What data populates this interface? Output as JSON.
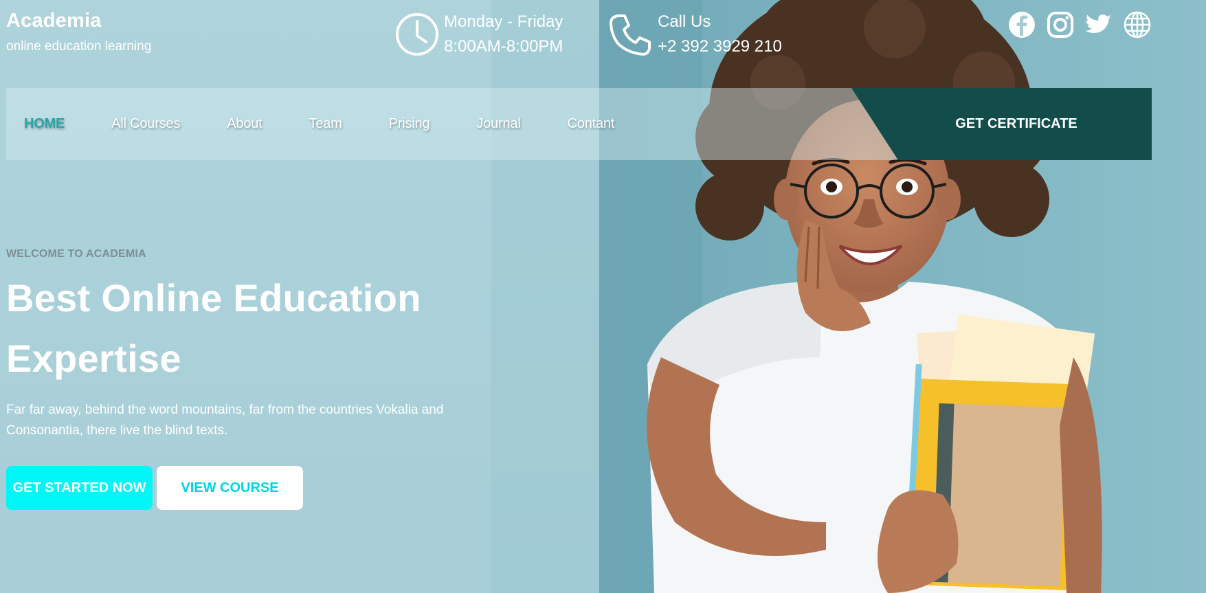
{
  "brand": {
    "name": "Academia",
    "tagline": "online education learning"
  },
  "contact": {
    "hours_title": "Monday - Friday",
    "hours_value": "8:00AM-8:00PM",
    "call_title": "Call Us",
    "call_value": "+2 392 3929 210"
  },
  "socials": [
    "facebook-icon",
    "instagram-icon",
    "twitter-icon",
    "globe-icon"
  ],
  "nav": {
    "items": [
      {
        "label": "HOME",
        "active": true
      },
      {
        "label": "All Courses",
        "active": false
      },
      {
        "label": "About",
        "active": false
      },
      {
        "label": "Team",
        "active": false
      },
      {
        "label": "Prising",
        "active": false
      },
      {
        "label": "Journal",
        "active": false
      },
      {
        "label": "Contant",
        "active": false
      }
    ],
    "cta_label": "GET CERTIFICATE"
  },
  "hero": {
    "eyebrow": "WELCOME TO ACADEMIA",
    "title": "Best Online Education Expertise",
    "description": "Far far away, behind the word mountains, far from the countries Vokalia and Consonantia, there live the blind texts.",
    "primary_button": "GET STARTED NOW",
    "secondary_button": "VIEW COURSE"
  },
  "colors": {
    "background": "#a6cdd6",
    "accent": "#00f6f7",
    "nav_active": "#2aa6a8",
    "cta_dark": "#134d4b",
    "secondary_text": "#00d4e6"
  }
}
